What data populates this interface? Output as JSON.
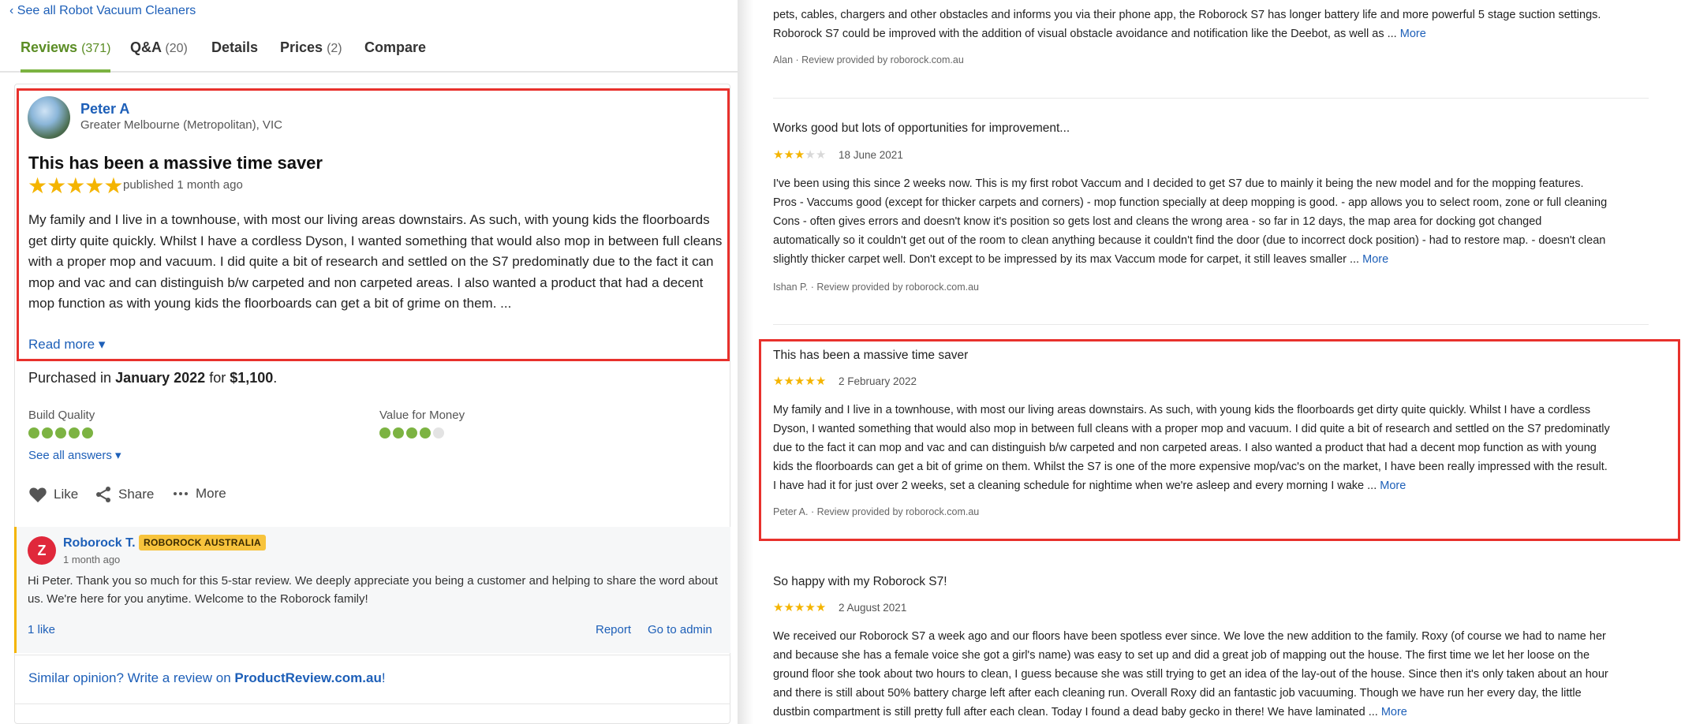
{
  "left": {
    "back_link": "‹ See all Robot Vacuum Cleaners",
    "tabs": [
      {
        "label": "Reviews",
        "count": "(371)"
      },
      {
        "label": "Q&A",
        "count": "(20)"
      },
      {
        "label": "Details",
        "count": ""
      },
      {
        "label": "Prices",
        "count": "(2)"
      },
      {
        "label": "Compare",
        "count": ""
      }
    ],
    "review": {
      "author": "Peter A",
      "location": "Greater Melbourne (Metropolitan), VIC",
      "title": "This has been a massive time saver",
      "stars": "★★★★★",
      "published": "published 1 month ago",
      "body": "My family and I live in a townhouse, with most our living areas downstairs. As such, with young kids the floorboards get dirty quite quickly. Whilst I have a cordless Dyson, I wanted something that would also mop in between full cleans with a proper mop and vacuum. I did quite a bit of research and settled on the S7 predominatly due to the fact it can mop and vac and can distinguish b/w carpeted and non carpeted areas. I also wanted a product that had a decent mop function as with young kids the floorboards can get a bit of grime on them. ...",
      "read_more": "Read more ▾",
      "purchased_prefix": "Purchased in",
      "purchased_month": "January 2022",
      "purchased_for": "for",
      "purchased_price": "$1,100",
      "purchased_suffix": ".",
      "ratings": [
        {
          "label": "Build Quality",
          "value": 5,
          "max": 5
        },
        {
          "label": "Value for Money",
          "value": 4,
          "max": 5
        }
      ],
      "see_all_answers": "See all answers ▾",
      "actions": {
        "like": "Like",
        "share": "Share",
        "more": "More"
      }
    },
    "reply": {
      "avatar_letter": "Z",
      "name": "Roborock T.",
      "badge": "ROBOROCK AUSTRALIA",
      "time": "1 month ago",
      "body": "Hi Peter. Thank you so much for this 5-star review. We deeply appreciate you being a customer and helping to share the word about us. We're here for you anytime. Welcome to the Roborock family!",
      "likes": "1 like",
      "report": "Report",
      "admin": "Go to admin"
    },
    "similar": {
      "prefix": "Similar opinion? Write a review on",
      "site": "ProductReview.com.au",
      "suffix": "!"
    }
  },
  "right": {
    "reviews": [
      {
        "title": "",
        "date": "",
        "body_lines": [
          "pets, cables, chargers and other obstacles and informs you via their phone app, the Roborock S7 has longer battery life and more powerful 5 stage suction settings.",
          "Roborock S7 could be improved with the addition of visual obstacle avoidance and notification like the Deebot, as well as ..."
        ],
        "more": "More",
        "attribution": "Alan · Review provided by roborock.com.au"
      },
      {
        "title": "Works good but lots of opportunities for improvement...",
        "stars_on": 3,
        "stars_total": 5,
        "date": "18 June 2021",
        "body_lines": [
          "I've been using this since 2 weeks now. This is my first robot Vaccum and I decided to get S7 due to mainly it being the new model and for the mopping features.",
          "Pros - Vaccums good (except for thicker carpets and corners) - mop function specially at deep mopping is good. - app allows you to select room, zone or full cleaning",
          "Cons - often gives errors and doesn't know it's position so gets lost and cleans the wrong area - so far in 12 days, the map area for docking got changed",
          "automatically so it couldn't get out of the room to clean anything because it couldn't find the door (due to incorrect dock position) - had to restore map. - doesn't clean",
          "slightly thicker carpet well. Don't except to be impressed by its max Vaccum mode for carpet, it still leaves smaller ..."
        ],
        "more": "More",
        "attribution": "Ishan P. · Review provided by roborock.com.au"
      },
      {
        "title": "This has been a massive time saver",
        "stars_on": 5,
        "stars_total": 5,
        "date": "2 February 2022",
        "body_lines": [
          "My family and I live in a townhouse, with most our living areas downstairs. As such, with young kids the floorboards get dirty quite quickly. Whilst I have a cordless",
          "Dyson, I wanted something that would also mop in between full cleans with a proper mop and vacuum. I did quite a bit of research and settled on the S7 predominatly",
          "due to the fact it can mop and vac and can distinguish b/w carpeted and non carpeted areas. I also wanted a product that had a decent mop function as with young",
          "kids the floorboards can get a bit of grime on them. Whilst the S7 is one of the more expensive mop/vac's on the market, I have been really impressed with the result.",
          "I have had it for just over 2 weeks, set a cleaning schedule for nightime when we're asleep and every morning I wake ..."
        ],
        "more": "More",
        "attribution": "Peter A. · Review provided by roborock.com.au"
      },
      {
        "title": "So happy with my Roborock S7!",
        "stars_on": 5,
        "stars_total": 5,
        "date": "2 August 2021",
        "body_lines": [
          "We received our Roborock S7 a week ago and our floors have been spotless ever since. We love the new addition to the family. Roxy (of course we had to name her",
          "and because she has a female voice she got a girl's name) was easy to set up and did a great job of mapping out the house. The first time we let her loose on the",
          "ground floor she took about two hours to clean, I guess because she was still trying to get an idea of the lay-out of the house. Since then it's only taken about an hour",
          "and there is still about 50% battery charge left after each cleaning run. Overall Roxy did an fantastic job vacuuming. Though we have run her every day, the little",
          "dustbin compartment is still pretty full after each clean. Today I found a dead baby gecko in there! We have laminated ..."
        ],
        "more": "More",
        "attribution": ""
      }
    ]
  },
  "colors": {
    "link": "#1d5fb8",
    "active_tab": "#5b8d25",
    "rating_green": "#7cb342",
    "star": "#f4b400",
    "highlight": "#e8312c",
    "badge": "#f7c33c"
  }
}
